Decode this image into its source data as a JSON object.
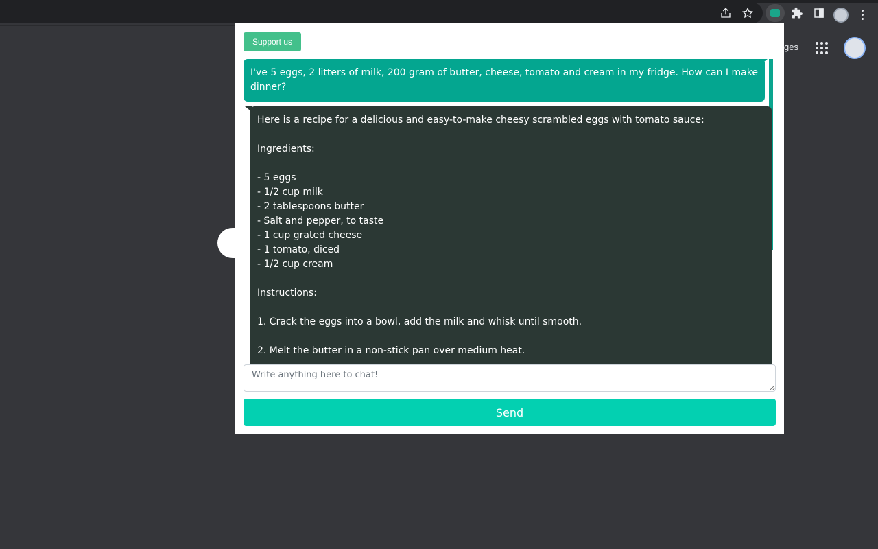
{
  "browser": {
    "toolbar_icons": [
      "share-icon",
      "bookmark-star-icon",
      "extension-chatbot-icon",
      "puzzle-extensions-icon",
      "side-panel-icon",
      "profile-avatar",
      "more-menu-icon"
    ]
  },
  "background_page": {
    "images_link_partial": "ges"
  },
  "popup": {
    "support_label": "Support us",
    "messages": [
      {
        "role": "user",
        "text": "I've 5 eggs, 2 litters of milk, 200 gram of butter, cheese, tomato and cream in my fridge. How can I make dinner?"
      },
      {
        "role": "assistant",
        "text": "Here is a recipe for a delicious and easy-to-make cheesy scrambled eggs with tomato sauce:\n\nIngredients:\n\n- 5 eggs\n- 1/2 cup milk\n- 2 tablespoons butter\n- Salt and pepper, to taste\n- 1 cup grated cheese\n- 1 tomato, diced\n- 1/2 cup cream\n\nInstructions:\n\n1. Crack the eggs into a bowl, add the milk and whisk until smooth.\n\n2. Melt the butter in a non-stick pan over medium heat."
      }
    ],
    "input_placeholder": "Write anything here to chat!",
    "send_label": "Send"
  },
  "colors": {
    "user_bubble": "#04a690",
    "assistant_bubble": "#2b3834",
    "support_button": "#43c08b",
    "send_button": "#03d0b1"
  }
}
